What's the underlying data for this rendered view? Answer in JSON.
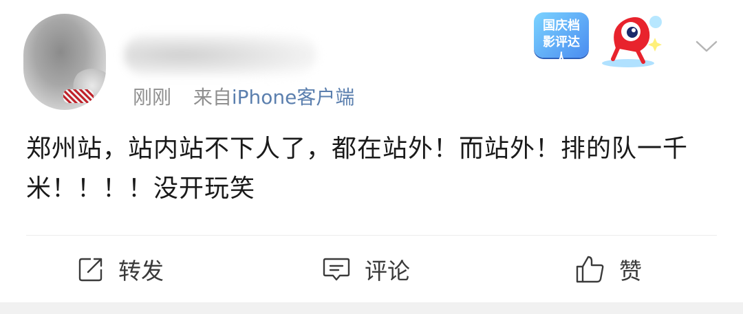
{
  "post": {
    "time": "刚刚",
    "from_label": "来自",
    "source": "iPhone客户端",
    "badge_text": "国庆档影评达人",
    "content": "郑州站，站内站不下人了，都在站外！而站外！排的队一千米！！！！没开玩笑"
  },
  "actions": {
    "repost": "转发",
    "comment": "评论",
    "like": "赞"
  }
}
